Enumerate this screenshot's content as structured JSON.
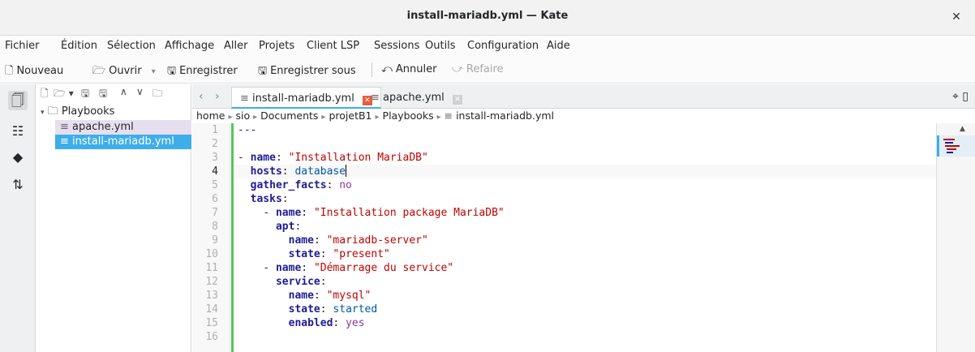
{
  "window": {
    "title": "install-mariadb.yml — Kate",
    "close_label": "✕"
  },
  "menu": [
    "Fichier",
    "Édition",
    "Sélection",
    "Affichage",
    "Aller",
    "Projets",
    "Client LSP",
    "Sessions",
    "Outils",
    "Configuration",
    "Aide"
  ],
  "toolbar": {
    "new_label": "Nouveau",
    "open_label": "Ouvrir",
    "save_label": "Enregistrer",
    "save_as_label": "Enregistrer sous",
    "undo_label": "Annuler",
    "redo_label": "Refaire"
  },
  "file_tree": {
    "folder": "Playbooks",
    "files": [
      "apache.yml",
      "install-mariadb.yml"
    ]
  },
  "tabs": [
    {
      "label": "install-mariadb.yml",
      "active": true
    },
    {
      "label": "apache.yml",
      "active": false
    }
  ],
  "breadcrumb": [
    "home",
    "sio",
    "Documents",
    "projetB1",
    "Playbooks",
    "install-mariadb.yml"
  ],
  "editor": {
    "current_line": 4,
    "lines": [
      {
        "n": "1",
        "indent": "",
        "parts": [
          [
            "dash",
            "---"
          ]
        ]
      },
      {
        "n": "2",
        "indent": "",
        "parts": []
      },
      {
        "n": "3",
        "indent": "",
        "parts": [
          [
            "p",
            "- "
          ],
          [
            "k",
            "name"
          ],
          [
            "p",
            ": "
          ],
          [
            "s",
            "\"Installation MariaDB\""
          ]
        ]
      },
      {
        "n": "4",
        "indent": "  ",
        "parts": [
          [
            "k",
            "hosts"
          ],
          [
            "p",
            ": "
          ],
          [
            "v",
            "database"
          ]
        ]
      },
      {
        "n": "5",
        "indent": "  ",
        "parts": [
          [
            "k",
            "gather_facts"
          ],
          [
            "p",
            ": "
          ],
          [
            "y",
            "no"
          ]
        ]
      },
      {
        "n": "6",
        "indent": "  ",
        "parts": [
          [
            "k",
            "tasks"
          ],
          [
            "p",
            ":"
          ]
        ]
      },
      {
        "n": "7",
        "indent": "    ",
        "parts": [
          [
            "p",
            "- "
          ],
          [
            "k",
            "name"
          ],
          [
            "p",
            ": "
          ],
          [
            "s",
            "\"Installation package MariaDB\""
          ]
        ]
      },
      {
        "n": "8",
        "indent": "      ",
        "parts": [
          [
            "k",
            "apt"
          ],
          [
            "p",
            ":"
          ]
        ]
      },
      {
        "n": "9",
        "indent": "        ",
        "parts": [
          [
            "k",
            "name"
          ],
          [
            "p",
            ": "
          ],
          [
            "s",
            "\"mariadb-server\""
          ]
        ]
      },
      {
        "n": "10",
        "indent": "        ",
        "parts": [
          [
            "k",
            "state"
          ],
          [
            "p",
            ": "
          ],
          [
            "s",
            "\"present\""
          ]
        ]
      },
      {
        "n": "11",
        "indent": "    ",
        "parts": [
          [
            "p",
            "- "
          ],
          [
            "k",
            "name"
          ],
          [
            "p",
            ": "
          ],
          [
            "s",
            "\"Démarrage du service\""
          ]
        ]
      },
      {
        "n": "12",
        "indent": "      ",
        "parts": [
          [
            "k",
            "service"
          ],
          [
            "p",
            ":"
          ]
        ]
      },
      {
        "n": "13",
        "indent": "        ",
        "parts": [
          [
            "k",
            "name"
          ],
          [
            "p",
            ": "
          ],
          [
            "s",
            "\"mysql\""
          ]
        ]
      },
      {
        "n": "14",
        "indent": "        ",
        "parts": [
          [
            "k",
            "state"
          ],
          [
            "p",
            ": "
          ],
          [
            "v",
            "started"
          ]
        ]
      },
      {
        "n": "15",
        "indent": "        ",
        "parts": [
          [
            "k",
            "enabled"
          ],
          [
            "p",
            ": "
          ],
          [
            "y",
            "yes"
          ]
        ]
      },
      {
        "n": "16",
        "indent": "",
        "parts": []
      }
    ]
  },
  "colors": {
    "accent": "#3daee9",
    "keyword": "#1f1c94",
    "string": "#bf0303",
    "value": "#0057ae",
    "boolean": "#8a3a9e",
    "modified_marker": "#55c655",
    "tab_close": "#e85d3a"
  },
  "icons": [
    "document-new-icon",
    "document-open-icon",
    "save-icon",
    "save-as-icon",
    "undo-icon",
    "redo-icon",
    "documents-icon",
    "projects-icon",
    "git-icon",
    "lsp-icon",
    "folder-icon",
    "file-text-icon"
  ]
}
